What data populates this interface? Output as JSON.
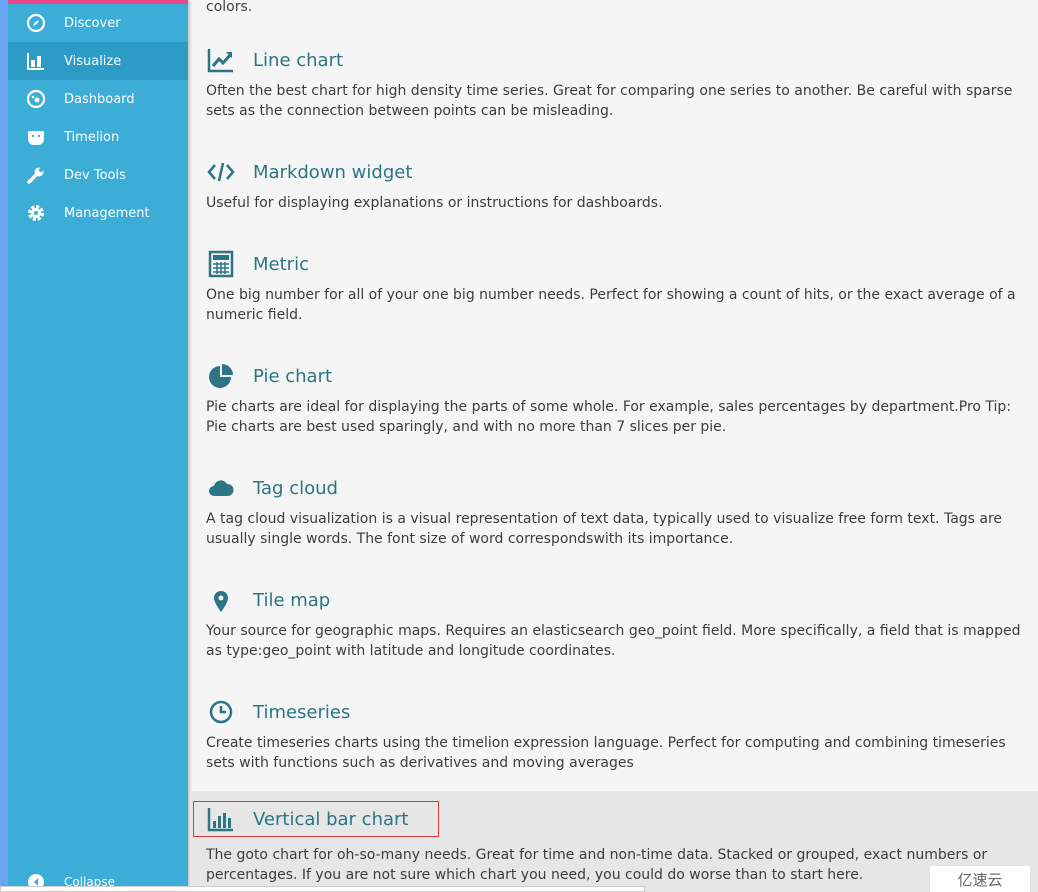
{
  "sidebar": {
    "items": [
      {
        "label": "Discover",
        "icon": "compass-icon"
      },
      {
        "label": "Visualize",
        "icon": "bar-chart-icon",
        "active": true
      },
      {
        "label": "Dashboard",
        "icon": "dashboard-icon"
      },
      {
        "label": "Timelion",
        "icon": "bear-icon"
      },
      {
        "label": "Dev Tools",
        "icon": "wrench-icon"
      },
      {
        "label": "Management",
        "icon": "gear-icon"
      }
    ],
    "collapse": "Collapse"
  },
  "main": {
    "top_fragment": "colors.",
    "items": [
      {
        "title": "Line chart",
        "desc": "Often the best chart for high density time series. Great for comparing one series to another. Be careful with sparse sets as the connection between points can be misleading."
      },
      {
        "title": "Markdown widget",
        "desc": "Useful for displaying explanations or instructions for dashboards."
      },
      {
        "title": "Metric",
        "desc": "One big number for all of your one big number needs. Perfect for showing a count of hits, or the exact average of a numeric field."
      },
      {
        "title": "Pie chart",
        "desc": "Pie charts are ideal for displaying the parts of some whole. For example, sales percentages by department.Pro Tip: Pie charts are best used sparingly, and with no more than 7 slices per pie."
      },
      {
        "title": "Tag cloud",
        "desc": "A tag cloud visualization is a visual representation of text data, typically used to visualize free form text. Tags are usually single words. The font size of word correspondswith its importance."
      },
      {
        "title": "Tile map",
        "desc": "Your source for geographic maps. Requires an elasticsearch geo_point field. More specifically, a field that is mapped as type:geo_point with latitude and longitude coordinates."
      },
      {
        "title": "Timeseries",
        "desc": "Create timeseries charts using the timelion expression language. Perfect for computing and combining timeseries sets with functions such as derivatives and moving averages"
      },
      {
        "title": "Vertical bar chart",
        "desc": "The goto chart for oh-so-many needs. Great for time and non-time data. Stacked or grouped, exact numbers or percentages. If you are not sure which chart you need, you could do worse than to start here."
      }
    ]
  },
  "watermark": "亿速云",
  "colors": {
    "sidebar": "#3badd6",
    "active": "#2c9bc6",
    "accent": "#2b7585",
    "highlight": "#e0363a"
  }
}
